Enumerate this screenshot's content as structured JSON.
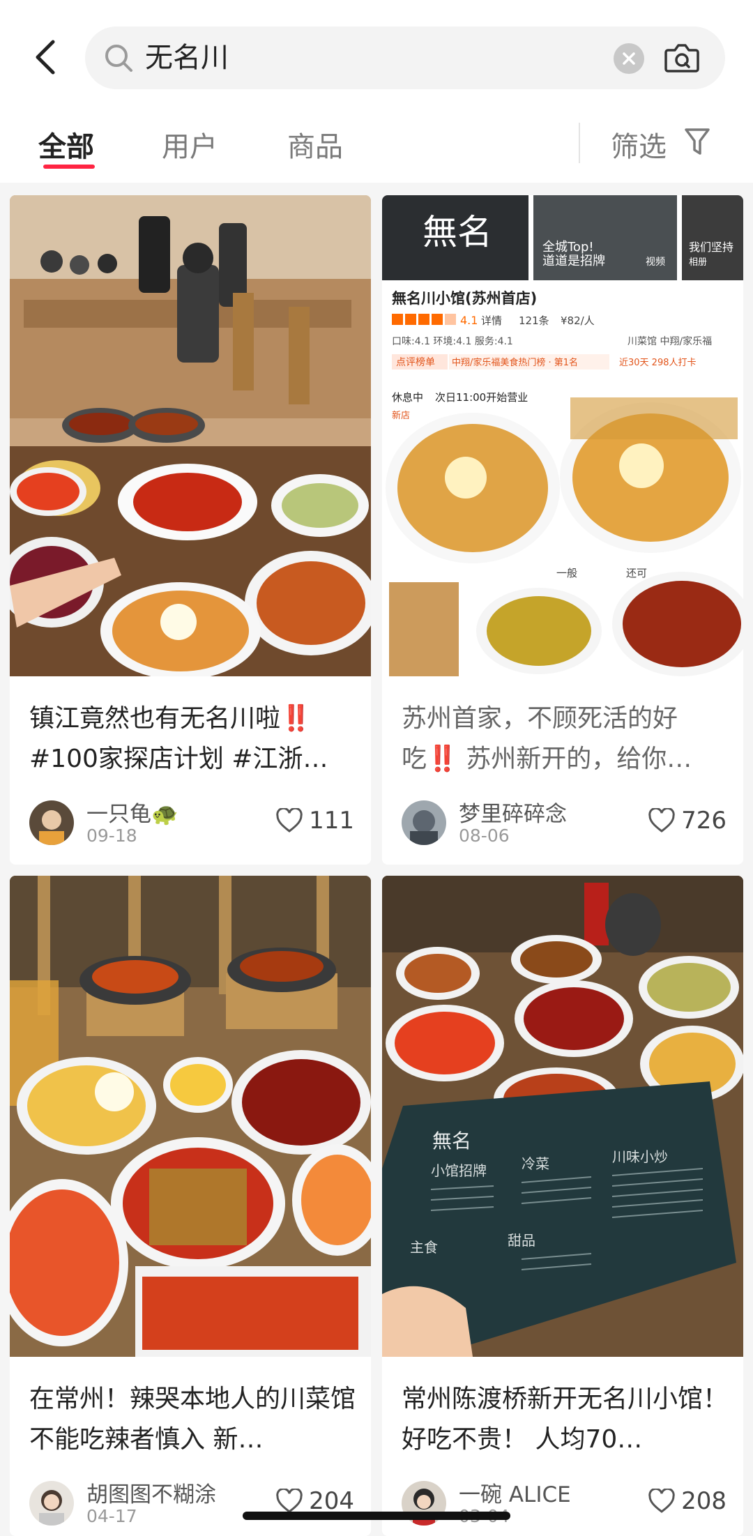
{
  "search": {
    "query": "无名川"
  },
  "tabs": {
    "all": "全部",
    "users": "用户",
    "goods": "商品",
    "filter": "筛选"
  },
  "posts": [
    {
      "title": "镇江竟然也有无名川啦‼️ #100家探店计划 #江浙…",
      "author": "一只龟🐢",
      "date": "09-18",
      "likes": "111"
    },
    {
      "title": "苏州首家，不顾死活的好吃‼️ 苏州新开的，给你…",
      "author": "梦里碎碎念",
      "date": "08-06",
      "likes": "726",
      "image_text": {
        "brand": "無名",
        "photo1": "全城Top!",
        "photo1_sub": "道道是招牌",
        "photo1_tag": "视频",
        "photo2": "我们坚持",
        "photo2_tag": "相册",
        "shop_name": "無名川小馆(苏州首店)",
        "rating": "4.1",
        "details": "详情",
        "reviews": "121条",
        "price": "¥82/人",
        "scores": "口味:4.1  环境:4.1  服务:4.1",
        "cuisine": "川菜馆  中翔/家乐福",
        "rank_tag": "点评榜单",
        "rank_text": "中翔/家乐福美食热门榜 · 第1名",
        "checkin": "近30天 298人打卡",
        "status": "休息中",
        "open_time": "次日11:00开始营业",
        "new_tag": "新店",
        "rate_ok": "一般",
        "rate_good": "还可"
      }
    },
    {
      "title": "在常州！辣哭本地人的川菜馆 不能吃辣者慎入 新…",
      "author": "胡图图不糊涂",
      "date": "04-17",
      "likes": "204"
    },
    {
      "title": "常州陈渡桥新开无名川小馆！好吃不贵！ 人均70…",
      "author": "一碗 ALICE",
      "date": "03-04",
      "likes": "208",
      "image_text": {
        "menu_brand": "無名",
        "menu_s1": "小馆招牌",
        "menu_s2": "冷菜",
        "menu_s3": "川味小炒",
        "menu_s4": "主食",
        "menu_s5": "甜品"
      }
    }
  ],
  "colors": {
    "accent": "#ff2442",
    "background": "#f5f5f5"
  }
}
